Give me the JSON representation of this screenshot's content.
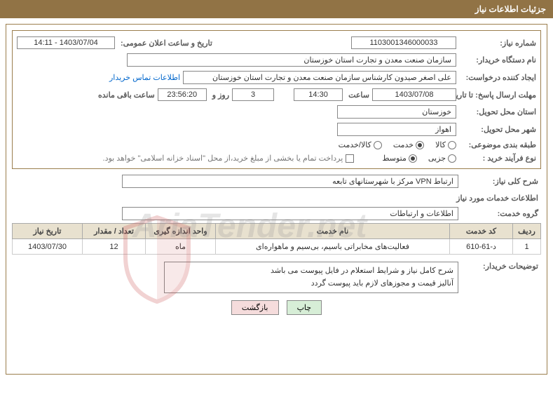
{
  "header": {
    "title": "جزئیات اطلاعات نیاز"
  },
  "fields": {
    "need_no_label": "شماره نیاز:",
    "need_no": "1103001346000033",
    "announce_label": "تاریخ و ساعت اعلان عمومی:",
    "announce_value": "1403/07/04 - 14:11",
    "buyer_org_label": "نام دستگاه خریدار:",
    "buyer_org": "سازمان صنعت معدن و تجارت استان خوزستان",
    "requester_label": "ایجاد کننده درخواست:",
    "requester": "علی اصغر صیدون کارشناس سازمان صنعت معدن و تجارت استان خوزستان",
    "contact_link": "اطلاعات تماس خریدار",
    "deadline_label": "مهلت ارسال پاسخ: تا تاریخ:",
    "deadline_date": "1403/07/08",
    "time_label": "ساعت",
    "deadline_time": "14:30",
    "days_remaining": "3",
    "days_text": "روز و",
    "hours_remaining": "23:56:20",
    "remaining_text": "ساعت باقی مانده",
    "province_label": "استان محل تحویل:",
    "province": "خوزستان",
    "city_label": "شهر محل تحویل:",
    "city": "اهواز",
    "category_label": "طبقه بندی موضوعی:",
    "radio_goods": "کالا",
    "radio_service": "خدمت",
    "radio_goods_service": "کالا/خدمت",
    "purchase_type_label": "نوع فرآیند خرید :",
    "radio_partial": "جزیی",
    "radio_medium": "متوسط",
    "treasury_note": "پرداخت تمام یا بخشی از مبلغ خرید،از محل \"اسناد خزانه اسلامی\" خواهد بود.",
    "need_desc_label": "شرح کلی نیاز:",
    "need_desc": "ارتباط VPN مرکز با شهرستانهای تابعه",
    "services_info_label": "اطلاعات خدمات مورد نیاز",
    "service_group_label": "گروه خدمت:",
    "service_group": "اطلاعات و ارتباطات",
    "buyer_notes_label": "توضیحات خریدار:",
    "buyer_notes_line1": "شرح کامل نیاز و شرایط استعلام در فایل پیوست می باشد",
    "buyer_notes_line2": "آنالیز قیمت و مجوزهای لازم  باید پیوست گردد"
  },
  "table": {
    "headers": {
      "row": "ردیف",
      "code": "کد خدمت",
      "name": "نام خدمت",
      "unit": "واحد اندازه گیری",
      "qty": "تعداد / مقدار",
      "date": "تاریخ نیاز"
    },
    "rows": [
      {
        "row": "1",
        "code": "د-61-610",
        "name": "فعالیت‌های مخابراتی باسیم، بی‌سیم و ماهواره‌ای",
        "unit": "ماه",
        "qty": "12",
        "date": "1403/07/30"
      }
    ]
  },
  "buttons": {
    "print": "چاپ",
    "back": "بازگشت"
  },
  "watermark": "AriaTender.net"
}
